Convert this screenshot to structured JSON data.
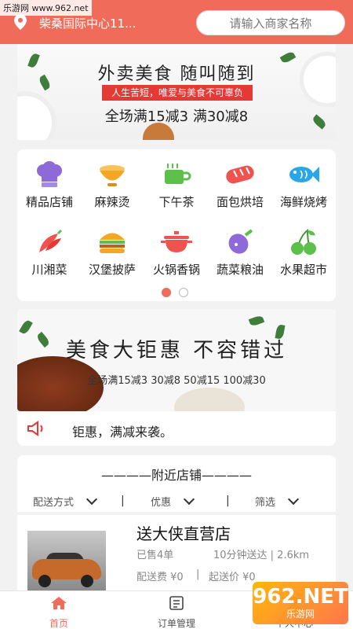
{
  "watermark": {
    "top_left": "乐游网 www.962.net",
    "logo_big": "962.NET",
    "logo_small": "乐游网"
  },
  "header": {
    "location": "柴桑国际中心11...",
    "search_placeholder": "请输入商家名称"
  },
  "banner1": {
    "title": "外卖美食  随叫随到",
    "subtitle": "人生苦短，唯爱与美食不可辜负",
    "offer": "全场满15减3  满30减8"
  },
  "categories": [
    {
      "label": "精品店铺",
      "icon": "chef-hat-icon",
      "color": "#8e6ad8"
    },
    {
      "label": "麻辣烫",
      "icon": "bowl-icon",
      "color": "#f5a623"
    },
    {
      "label": "下午茶",
      "icon": "tea-cup-icon",
      "color": "#5cc04b"
    },
    {
      "label": "面包烘培",
      "icon": "bread-icon",
      "color": "#ef5350"
    },
    {
      "label": "海鲜烧烤",
      "icon": "fish-icon",
      "color": "#29a6e8"
    },
    {
      "label": "川湘菜",
      "icon": "chili-icon",
      "color": "#ef5350"
    },
    {
      "label": "汉堡披萨",
      "icon": "burger-icon",
      "color": "#f5a623"
    },
    {
      "label": "火锅香锅",
      "icon": "hotpot-icon",
      "color": "#ef5350"
    },
    {
      "label": "蔬菜粮油",
      "icon": "eggplant-icon",
      "color": "#8e6ad8"
    },
    {
      "label": "水果超市",
      "icon": "cherry-icon",
      "color": "#5cc04b"
    }
  ],
  "banner2": {
    "title": "美食大钜惠 不容错过",
    "offer": "全场满15减3  30减8  50减15  100减30"
  },
  "notice": {
    "text": "钜惠，满减来袭。"
  },
  "nearby": {
    "title": "————附近店铺————"
  },
  "filters": {
    "delivery": "配送方式",
    "discount": "优惠",
    "filter": "筛选"
  },
  "shop": {
    "name": "送大侠直营店",
    "sold": "已售4单",
    "delivery_time": "10分钟送达 | 2.6km",
    "fee": "配送费 ¥0",
    "min_order": "起送价 ¥0"
  },
  "tabs": [
    {
      "label": "首页",
      "icon": "home-icon"
    },
    {
      "label": "订单管理",
      "icon": "order-icon"
    },
    {
      "label": "个人中心",
      "icon": "user-icon"
    }
  ],
  "colors": {
    "brand": "#f06b5a",
    "offer_red": "#e53935"
  }
}
